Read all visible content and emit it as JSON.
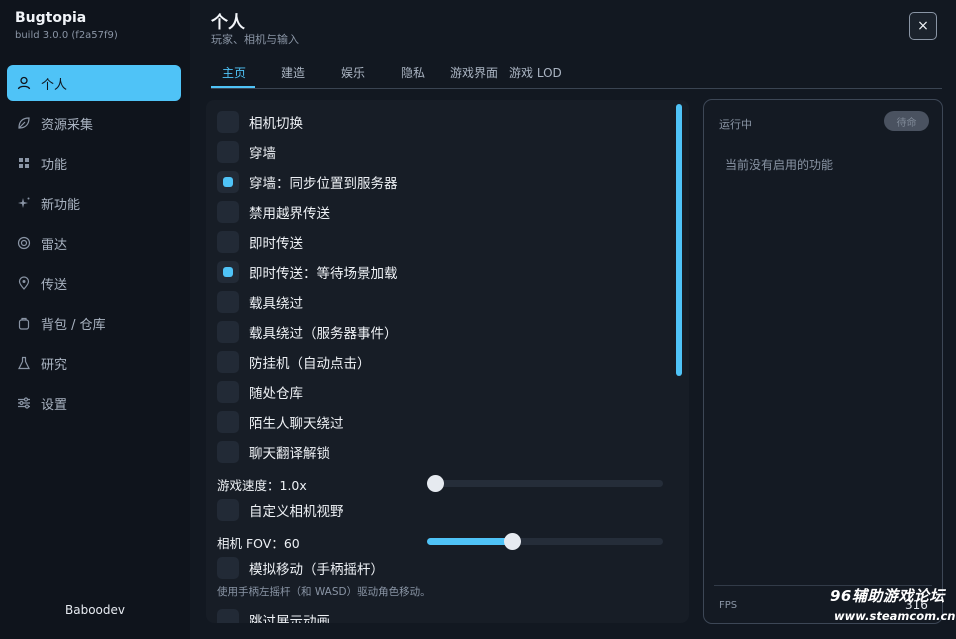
{
  "app": {
    "title": "Bugtopia",
    "build": "build 3.0.0 (f2a57f9)"
  },
  "sidebar": {
    "items": [
      {
        "label": "个人",
        "icon": "user-icon",
        "active": true
      },
      {
        "label": "资源采集",
        "icon": "leaf-icon"
      },
      {
        "label": "功能",
        "icon": "grid-icon"
      },
      {
        "label": "新功能",
        "icon": "sparkle-icon"
      },
      {
        "label": "雷达",
        "icon": "radar-icon"
      },
      {
        "label": "传送",
        "icon": "map-pin-icon"
      },
      {
        "label": "背包 / 仓库",
        "icon": "backpack-icon"
      },
      {
        "label": "研究",
        "icon": "flask-icon"
      },
      {
        "label": "设置",
        "icon": "sliders-icon"
      }
    ],
    "user": "Baboodev"
  },
  "header": {
    "title": "个人",
    "subtitle": "玩家、相机与输入",
    "close_label": "×"
  },
  "tabs": [
    {
      "label": "主页",
      "active": true
    },
    {
      "label": "建造"
    },
    {
      "label": "娱乐"
    },
    {
      "label": "隐私"
    },
    {
      "label": "游戏界面"
    },
    {
      "label": "游戏 LOD"
    }
  ],
  "options": [
    {
      "label": "相机切换",
      "checked": false
    },
    {
      "label": "穿墙",
      "checked": false
    },
    {
      "label": "穿墙：同步位置到服务器",
      "checked": true
    },
    {
      "label": "禁用越界传送",
      "checked": false
    },
    {
      "label": "即时传送",
      "checked": false
    },
    {
      "label": "即时传送：等待场景加载",
      "checked": true
    },
    {
      "label": "载具绕过",
      "checked": false
    },
    {
      "label": "载具绕过（服务器事件）",
      "checked": false
    },
    {
      "label": "防挂机（自动点击）",
      "checked": false
    },
    {
      "label": "随处仓库",
      "checked": false
    },
    {
      "label": "陌生人聊天绕过",
      "checked": false
    },
    {
      "label": "聊天翻译解锁",
      "checked": false
    }
  ],
  "game_speed": {
    "label": "游戏速度：1.0x",
    "level": 0.0
  },
  "custom_fov": {
    "label": "自定义相机视野",
    "checked": false
  },
  "camera_fov": {
    "label": "相机 FOV：60",
    "level": 0.35
  },
  "gamepad_move": {
    "label": "模拟移动（手柄摇杆）",
    "checked": false,
    "hint": "使用手柄左摇杆（和 WASD）驱动角色移动。"
  },
  "partial_next": {
    "label": "跳过展示动画"
  },
  "running": {
    "title": "运行中",
    "badge": "待命",
    "empty": "当前没有启用的功能",
    "fps_label": "FPS",
    "fps_value": "316"
  },
  "watermark": {
    "line1": "96辅助游戏论坛",
    "line2": "www.steamcom.cn"
  },
  "colors": {
    "accent": "#4fc3f7",
    "background": "#121821",
    "sidebar": "#0f141c",
    "panel": "#171d26"
  }
}
